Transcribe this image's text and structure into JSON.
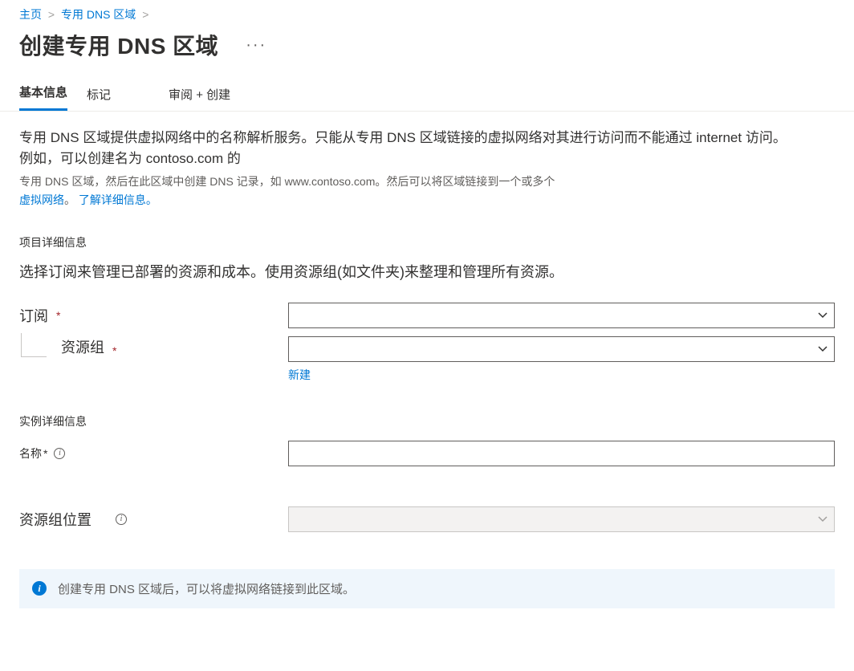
{
  "breadcrumb": {
    "home": "主页",
    "dns": "专用 DNS 区域"
  },
  "page": {
    "title": "创建专用 DNS 区域",
    "more": "···"
  },
  "tabs": {
    "basic": "基本信息",
    "tags": "标记",
    "review": "审阅 + 创建"
  },
  "intro": {
    "line1": "专用 DNS 区域提供虚拟网络中的名称解析服务。只能从专用 DNS 区域链接的虚拟网络对其进行访问而不能通过 internet 访问。例如，可以创建名为 contoso.com 的",
    "line2": "专用 DNS 区域，然后在此区域中创建 DNS 记录，如 www.contoso.com。然后可以将区域链接到一个或多个",
    "line3a": "虚拟网络",
    "line3b": "。",
    "learn": "了解详细信息。"
  },
  "project": {
    "heading": "项目详细信息",
    "desc": "选择订阅来管理已部署的资源和成本。使用资源组(如文件夹)来整理和管理所有资源。",
    "subscription_label": "订阅",
    "resource_group_label": "资源组",
    "create_new": "新建"
  },
  "instance": {
    "heading": "实例详细信息",
    "name_label": "名称",
    "location_label": "资源组位置"
  },
  "banner": {
    "text": "创建专用 DNS 区域后，可以将虚拟网络链接到此区域。"
  }
}
